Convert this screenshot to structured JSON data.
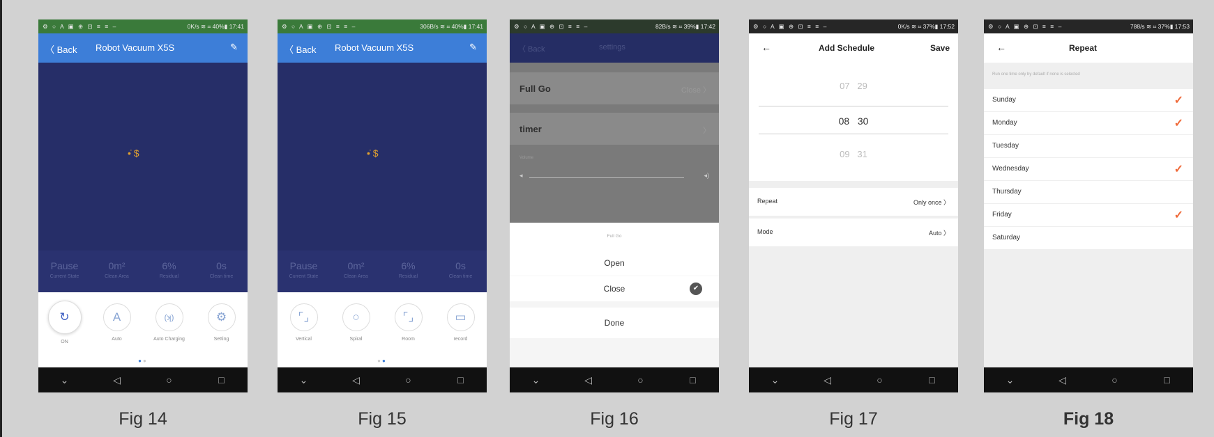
{
  "status_bar": {
    "left_icons": "⚙ ○ A ▣ ⊕ ⊡ ≡ ≡ –"
  },
  "fig14": {
    "caption": "Fig 14",
    "status_right": "0K/s ≋ ⌗ 40%▮ 17:41",
    "back": "〈 Back",
    "title": "Robot Vacuum X5S",
    "stats": [
      {
        "value": "Pause",
        "label": "Current State"
      },
      {
        "value": "0m²",
        "label": "Clean Area"
      },
      {
        "value": "6%",
        "label": "Residual"
      },
      {
        "value": "0s",
        "label": "Clean time"
      }
    ],
    "buttons": [
      {
        "glyph": "↻",
        "label": "ON"
      },
      {
        "glyph": "A",
        "label": "Auto"
      },
      {
        "glyph": "(ʞ)",
        "label": "Auto Charging"
      },
      {
        "glyph": "⚙",
        "label": "Setting"
      }
    ]
  },
  "fig15": {
    "caption": "Fig 15",
    "status_right": "306B/s ≋ ⌗ 40%▮ 17:41",
    "back": "〈 Back",
    "title": "Robot Vacuum X5S",
    "stats": [
      {
        "value": "Pause",
        "label": "Current State"
      },
      {
        "value": "0m²",
        "label": "Clean Area"
      },
      {
        "value": "6%",
        "label": "Residual"
      },
      {
        "value": "0s",
        "label": "Clean time"
      }
    ],
    "buttons": [
      {
        "glyph": "⌜⌟",
        "label": "Vertical"
      },
      {
        "glyph": "○",
        "label": "Spiral"
      },
      {
        "glyph": "⌜⌟",
        "label": "Room"
      },
      {
        "glyph": "▭",
        "label": "record"
      }
    ]
  },
  "fig16": {
    "caption": "Fig 16",
    "status_right": "82B/s ≋ ⌗ 39%▮ 17:42",
    "back": "〈 Back",
    "title": "settings",
    "row1_label": "Full Go",
    "row1_value": "Close 〉",
    "row2_label": "timer",
    "row2_value": "〉",
    "volume_label": "Volume",
    "sheet_title": "Full Go",
    "open": "Open",
    "close": "Close",
    "done": "Done"
  },
  "fig17": {
    "caption": "Fig 17",
    "status_right": "0K/s ≋ ⌗ 37%▮ 17:52",
    "title": "Add Schedule",
    "save": "Save",
    "picker": [
      {
        "h": "07",
        "m": "29"
      },
      {
        "h": "08",
        "m": "30"
      },
      {
        "h": "09",
        "m": "31"
      }
    ],
    "repeat_label": "Repeat",
    "repeat_value": "Only once 〉",
    "mode_label": "Mode",
    "mode_value": "Auto 〉"
  },
  "fig18": {
    "caption": "Fig 18",
    "status_right": "788/s ≋ ⌗ 37%▮ 17:53",
    "title": "Repeat",
    "hint": "Run one time only by default if none is selected",
    "days": [
      {
        "name": "Sunday",
        "checked": true
      },
      {
        "name": "Monday",
        "checked": true
      },
      {
        "name": "Tuesday",
        "checked": false
      },
      {
        "name": "Wednesday",
        "checked": true
      },
      {
        "name": "Thursday",
        "checked": false
      },
      {
        "name": "Friday",
        "checked": true
      },
      {
        "name": "Saturday",
        "checked": false
      }
    ]
  },
  "nav": {
    "down": "⌄",
    "back": "◁",
    "home": "○",
    "recent": "□"
  },
  "icons": {
    "back_arrow": "←",
    "edit": "✎",
    "check": "✓",
    "checked_circle": "✔",
    "robot": "•̇ $"
  },
  "colors": {
    "blue_header": "#3d7ed8",
    "map_bg": "#262e68",
    "check_orange": "#ef6a3a"
  }
}
